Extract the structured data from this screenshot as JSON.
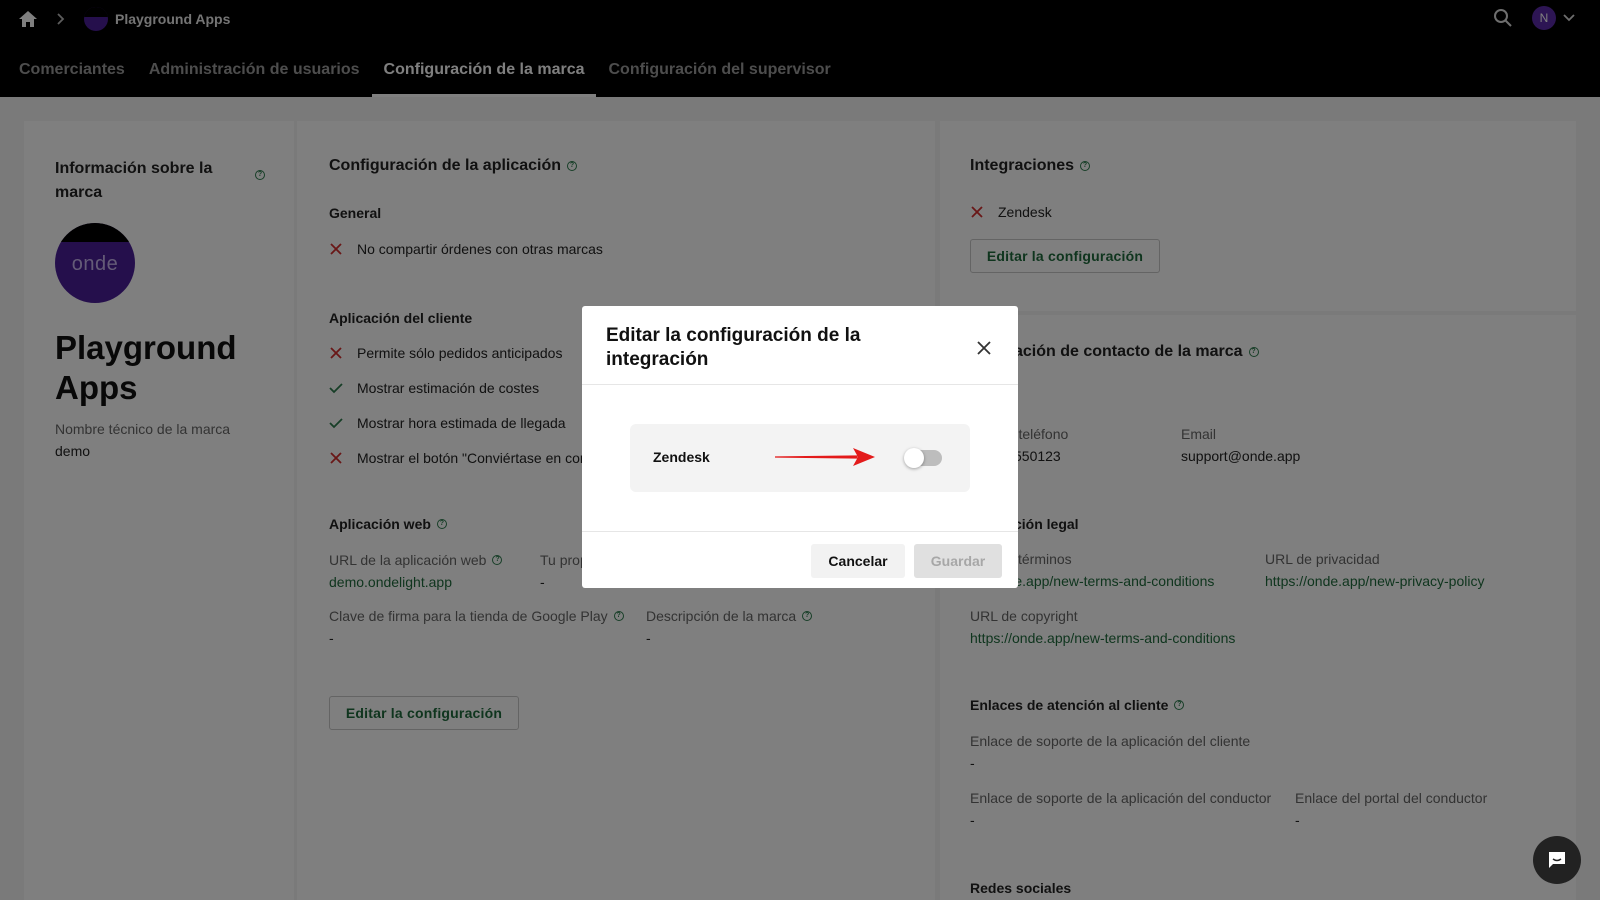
{
  "header": {
    "app_name": "Playground Apps",
    "avatar_initial": "N"
  },
  "tabs": [
    {
      "label": "Comerciantes"
    },
    {
      "label": "Administración de usuarios"
    },
    {
      "label": "Configuración de la marca",
      "active": true
    },
    {
      "label": "Configuración del supervisor"
    }
  ],
  "brand": {
    "title": "Información sobre la marca",
    "logo_text": "onde",
    "name": "Playground Apps",
    "tech_name_label": "Nombre técnico de la marca",
    "tech_name_value": "demo"
  },
  "app_config": {
    "title": "Configuración de la aplicación",
    "general_title": "General",
    "general_items": [
      {
        "text": "No compartir órdenes con otras marcas",
        "enabled": false
      }
    ],
    "client_title": "Aplicación del cliente",
    "client_items": [
      {
        "text": "Permite sólo pedidos anticipados",
        "enabled": false
      },
      {
        "text": "Mostrar estimación de costes",
        "enabled": true
      },
      {
        "text": "Mostrar hora estimada de llegada",
        "enabled": true
      },
      {
        "text": "Mostrar el botón \"Conviértase en con",
        "enabled": false
      }
    ],
    "web_title": "Aplicación web",
    "web_url_label": "URL de la aplicación web",
    "web_url_value": "demo.ondelight.app",
    "own_label": "Tu prop",
    "own_value": "-",
    "play_key_label": "Clave de firma para la tienda de Google Play",
    "play_key_value": "-",
    "brand_desc_label": "Descripción de la marca",
    "brand_desc_value": "-",
    "edit_button": "Editar la configuración"
  },
  "integrations": {
    "title": "Integraciones",
    "items": [
      {
        "text": "Zendesk",
        "enabled": false
      }
    ],
    "edit_button": "Editar la configuración"
  },
  "contact": {
    "title_partial": "ación de contacto de la marca",
    "phone_label_partial": "de teléfono",
    "phone_value_partial": "550123",
    "email_label": "Email",
    "email_value": "support@onde.app",
    "legal_title_partial": "ción legal",
    "terms_label_partial": "términos",
    "terms_value_partial": "onde.app/new-terms-and-conditions",
    "privacy_label": "URL de privacidad",
    "privacy_value": "https://onde.app/new-privacy-policy",
    "copyright_label": "URL de copyright",
    "copyright_value": "https://onde.app/new-terms-and-conditions",
    "support_title": "Enlaces de atención al cliente",
    "client_support_label": "Enlace de soporte de la aplicación del cliente",
    "client_support_value": "-",
    "driver_support_label": "Enlace de soporte de la aplicación del conductor",
    "driver_support_value": "-",
    "driver_portal_label": "Enlace del portal del conductor",
    "driver_portal_value": "-",
    "social_title": "Redes sociales"
  },
  "modal": {
    "title": "Editar la configuración de la integración",
    "integration_name": "Zendesk",
    "toggle_on": false,
    "cancel_label": "Cancelar",
    "save_label": "Guardar"
  },
  "colors": {
    "accent_green": "#1f6b3c",
    "brand_purple": "#4a1f99",
    "error_red": "#d32f2f",
    "success_green": "#2e7d4f",
    "annotation_arrow": "#e31b1b"
  }
}
